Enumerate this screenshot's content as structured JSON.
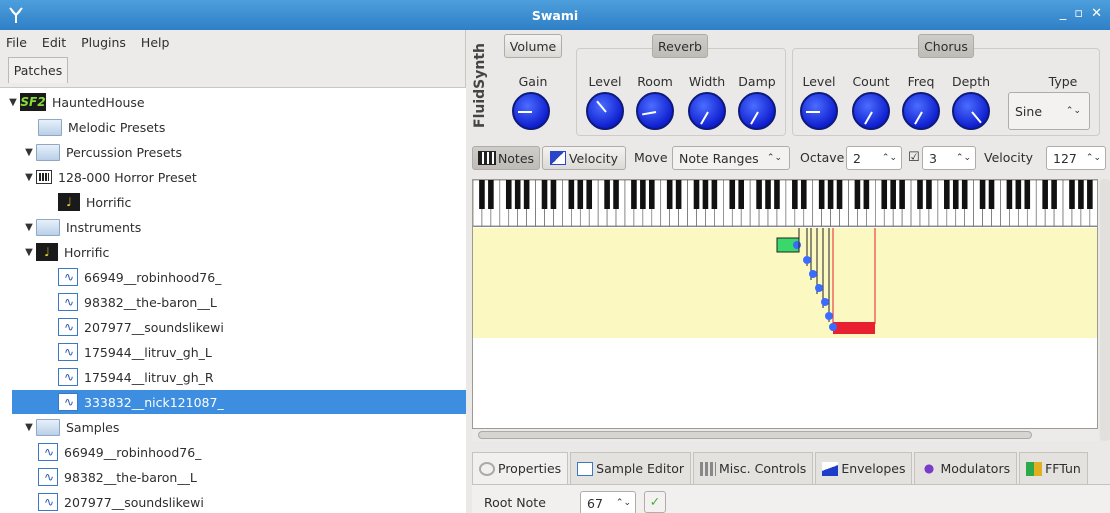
{
  "window": {
    "title": "Swami",
    "controls": [
      "_",
      "▫",
      "✕"
    ]
  },
  "menu": [
    "File",
    "Edit",
    "Plugins",
    "Help"
  ],
  "left_tab": "Patches",
  "tree": [
    {
      "label": "HauntedHouse",
      "icon": "sf2-icon",
      "iconText": "SF2",
      "level": 0,
      "arrow": "▼"
    },
    {
      "label": "Melodic Presets",
      "icon": "folder-icon",
      "level": 1,
      "arrow": ""
    },
    {
      "label": "Percussion Presets",
      "icon": "folder-icon",
      "level": 1,
      "arrow": "▼"
    },
    {
      "label": "128-000 Horror Preset",
      "icon": "preset-icon",
      "level": 2,
      "arrow": "▼"
    },
    {
      "label": "Horrific",
      "icon": "instrument-icon",
      "level": 3,
      "arrow": ""
    },
    {
      "label": "Instruments",
      "icon": "folder-icon",
      "level": 1,
      "arrow": "▼"
    },
    {
      "label": "Horrific",
      "icon": "instrument-icon",
      "level": 2,
      "arrow": "▼"
    },
    {
      "label": "66949__robinhood76_",
      "icon": "sample-icon",
      "level": 3,
      "arrow": ""
    },
    {
      "label": "98382__the-baron__L",
      "icon": "sample-icon",
      "level": 3,
      "arrow": ""
    },
    {
      "label": "207977__soundslikewi",
      "icon": "sample-icon",
      "level": 3,
      "arrow": ""
    },
    {
      "label": "175944__litruv_gh_L",
      "icon": "sample-icon",
      "level": 3,
      "arrow": ""
    },
    {
      "label": "175944__litruv_gh_R",
      "icon": "sample-icon",
      "level": 3,
      "arrow": ""
    },
    {
      "label": "333832__nick121087_",
      "icon": "sample-icon",
      "level": 3,
      "arrow": "",
      "selected": true
    },
    {
      "label": "Samples",
      "icon": "folder-icon",
      "level": 1,
      "arrow": "▼"
    },
    {
      "label": "66949__robinhood76_",
      "icon": "sample-icon",
      "level": 2,
      "arrow": ""
    },
    {
      "label": "98382__the-baron__L",
      "icon": "sample-icon",
      "level": 2,
      "arrow": ""
    },
    {
      "label": "207977__soundslikewi",
      "icon": "sample-icon",
      "level": 2,
      "arrow": ""
    }
  ],
  "synth": {
    "side_label": "FluidSynth",
    "volume_btn": "Volume",
    "gain_label": "Gain",
    "reverb_btn": "Reverb",
    "reverb_labels": [
      "Level",
      "Room",
      "Width",
      "Damp"
    ],
    "chorus_btn": "Chorus",
    "chorus_labels": [
      "Level",
      "Count",
      "Freq",
      "Depth"
    ],
    "type_label": "Type",
    "type_value": "Sine"
  },
  "toolbar": {
    "notes": "Notes",
    "velocity_btn": "Velocity",
    "move_label": "Move",
    "move_value": "Note Ranges",
    "octave_label": "Octave",
    "octave_value": "2",
    "octave2_value": "3",
    "velocity_label": "Velocity",
    "velocity_value": "127"
  },
  "bottom_tabs": [
    "Properties",
    "Sample Editor",
    "Misc. Controls",
    "Envelopes",
    "Modulators",
    "FFTun"
  ],
  "props": {
    "root_note_label": "Root Note",
    "root_note_value": "67"
  },
  "colors": {
    "accent": "#3d8ee0",
    "range_bg": "#fbf8c1",
    "selected_range": "#e8202f",
    "key_range": "#39d86a"
  }
}
